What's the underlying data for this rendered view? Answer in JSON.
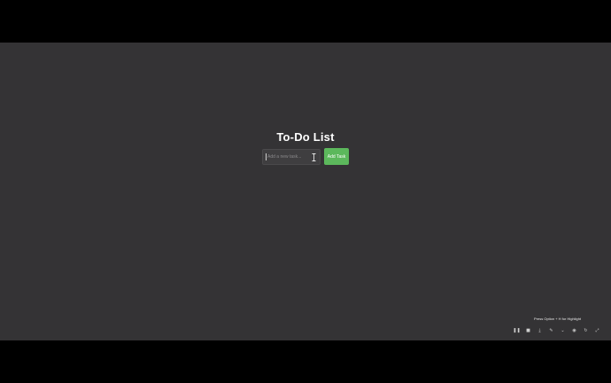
{
  "app": {
    "title": "To-Do List",
    "input_placeholder": "Add a new task...",
    "add_button_label": "Add Task"
  },
  "recorder": {
    "hint": "Press Option + H for Highlight",
    "controls": [
      {
        "name": "pause-icon",
        "glyph": "❚❚"
      },
      {
        "name": "stop-icon",
        "glyph": "■"
      },
      {
        "name": "download-icon",
        "glyph": "⤓"
      },
      {
        "name": "pen-icon",
        "glyph": "✎"
      },
      {
        "name": "chevron-down-icon",
        "glyph": "⌄"
      },
      {
        "name": "camera-icon",
        "glyph": "◉"
      },
      {
        "name": "restart-icon",
        "glyph": "↻"
      },
      {
        "name": "expand-icon",
        "glyph": "⤢"
      }
    ]
  },
  "colors": {
    "app_background": "#343335",
    "letterbox": "#000000",
    "add_button": "#5cb85c",
    "title_text": "#ffffff"
  }
}
